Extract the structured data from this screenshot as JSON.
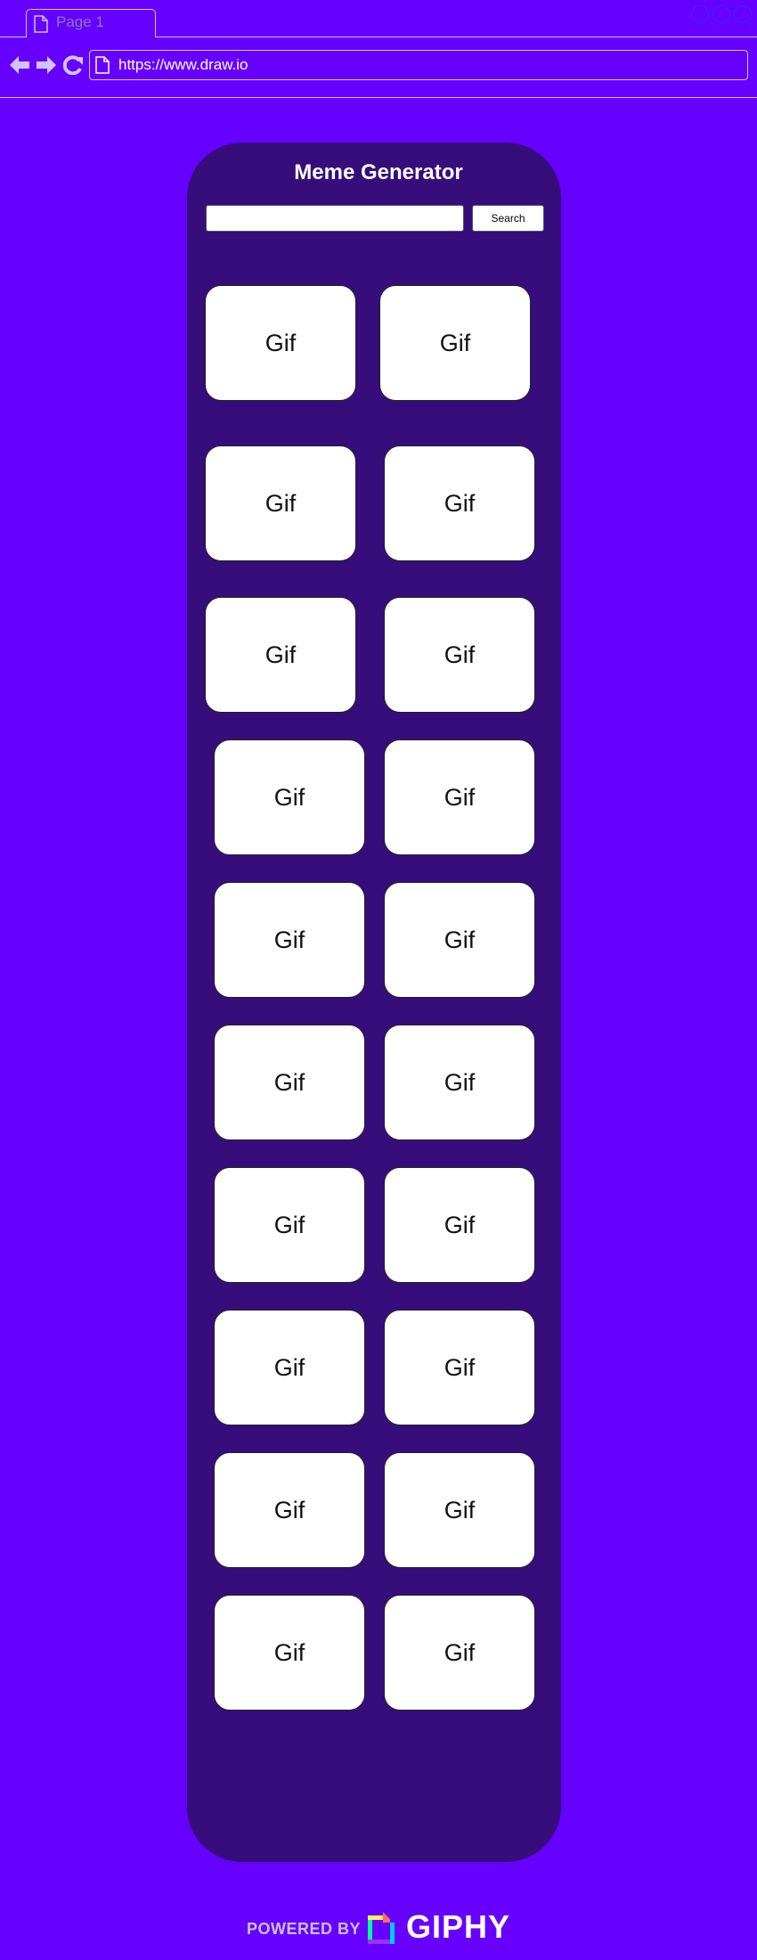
{
  "browser": {
    "tab_label": "Page 1",
    "url": "https://www.draw.io"
  },
  "app": {
    "title": "Meme Generator",
    "search": {
      "value": "",
      "placeholder": "",
      "button_label": "Search"
    },
    "gifs": [
      {
        "label": "Gif"
      },
      {
        "label": "Gif"
      },
      {
        "label": "Gif"
      },
      {
        "label": "Gif"
      },
      {
        "label": "Gif"
      },
      {
        "label": "Gif"
      },
      {
        "label": "Gif"
      },
      {
        "label": "Gif"
      },
      {
        "label": "Gif"
      },
      {
        "label": "Gif"
      },
      {
        "label": "Gif"
      },
      {
        "label": "Gif"
      },
      {
        "label": "Gif"
      },
      {
        "label": "Gif"
      },
      {
        "label": "Gif"
      },
      {
        "label": "Gif"
      },
      {
        "label": "Gif"
      },
      {
        "label": "Gif"
      },
      {
        "label": "Gif"
      },
      {
        "label": "Gif"
      }
    ]
  },
  "footer": {
    "powered_by": "POWERED BY",
    "brand": "GIPHY"
  },
  "colors": {
    "page_background": "#6600FF",
    "panel_background": "#370D7C",
    "card_background": "#FFFFFF"
  },
  "icons": {
    "back": "arrow-left-icon",
    "forward": "arrow-right-icon",
    "reload": "reload-icon",
    "page": "page-icon"
  }
}
